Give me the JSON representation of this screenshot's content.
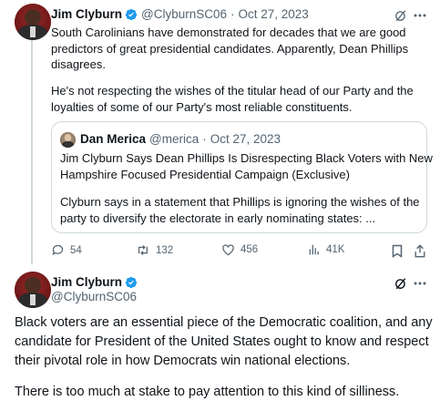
{
  "tweet1": {
    "name": "Jim Clyburn",
    "handle": "@ClyburnSC06",
    "separator": "·",
    "date": "Oct 27, 2023",
    "text_lines_1": [
      "South Carolinians have demonstrated for decades that we are good",
      "predictors of great presidential candidates. Apparently, Dean Phillips",
      "disagrees."
    ],
    "text_lines_2": [
      "He's not respecting the wishes of the titular head of our Party and the",
      "loyalties of some of our Party's most reliable constituents."
    ],
    "quote": {
      "name": "Dan Merica",
      "handle": "@merica",
      "separator": "·",
      "date": "Oct 27, 2023",
      "lines_1": [
        "Jim Clyburn Says Dean Phillips Is Disrespecting Black Voters with New",
        "Hampshire Focused Presidential Campaign (Exclusive)"
      ],
      "lines_2": [
        "Clyburn says in a statement that Phillips is ignoring the wishes of the",
        "party to diversify the electorate in early nominating states: ..."
      ]
    },
    "actions": {
      "replies": "54",
      "reposts": "132",
      "likes": "456",
      "views": "41K"
    }
  },
  "tweet2": {
    "name": "Jim Clyburn",
    "handle": "@ClyburnSC06",
    "text_lines_1": [
      "Black voters are an essential piece of the Democratic coalition, and any",
      "candidate for President of the United States ought to know and respect",
      "their pivotal role in how Democrats win national elections."
    ],
    "text_lines_2": [
      "There is too much at stake to pay attention to this kind of silliness."
    ]
  },
  "icons": {
    "verified": "verified-badge-icon",
    "grok": "grok-icon",
    "more": "more-icon",
    "reply": "reply-icon",
    "repost": "repost-icon",
    "like": "like-icon",
    "views": "views-icon",
    "bookmark": "bookmark-icon",
    "share": "share-icon"
  },
  "colors": {
    "text": "#0f1419",
    "secondary": "#536471",
    "border": "#cfd9de",
    "verified": "#1d9bf0"
  }
}
